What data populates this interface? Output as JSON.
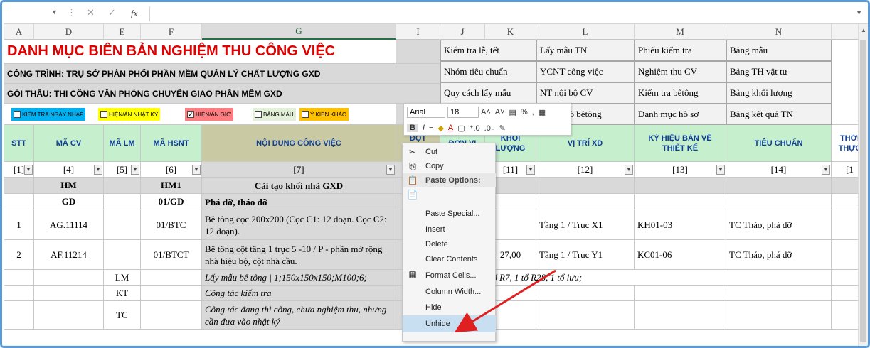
{
  "formula_bar": {
    "name_box": "",
    "fx": "fx",
    "cancel": "✕",
    "enter": "✓",
    "more": "⋮",
    "value": ""
  },
  "columns": [
    {
      "id": "A"
    },
    {
      "id": "D"
    },
    {
      "id": "E"
    },
    {
      "id": "F"
    },
    {
      "id": "G"
    },
    {
      "id": "I"
    },
    {
      "id": "J"
    },
    {
      "id": "K"
    },
    {
      "id": "L"
    },
    {
      "id": "M"
    },
    {
      "id": "N"
    }
  ],
  "sheet": {
    "title": "DANH MỤC BIÊN BẢN NGHIỆM THU CÔNG VIỆC",
    "project": "CÔNG TRÌNH: TRỤ SỞ PHÂN PHỐI PHẦN MỀM QUẢN LÝ CHẤT LƯỢNG GXD",
    "package": "GÓI THẦU: THI CÔNG VĂN PHÒNG CHUYỂN GIAO PHẦN MỀM GXD",
    "filters": [
      {
        "label": "KIỂM TRA NGÀY NHẬP",
        "checked": false,
        "color": "#00b0f0"
      },
      {
        "label": "HIỆN/ẨN NHẬT KÝ",
        "checked": false,
        "color": "#ffff00"
      },
      {
        "label": "HIỆN/ẨN GIỜ",
        "checked": true,
        "color": "#ff7c80"
      },
      {
        "label": "BẢNG MẪU",
        "checked": false,
        "color": "#e2efd9"
      },
      {
        "label": "Ý KIẾN KHÁC",
        "checked": false,
        "color": "#ffc000"
      }
    ],
    "quick_links": [
      [
        "Kiểm tra lễ, tết",
        "Lấy mẫu TN",
        "Phiếu kiểm tra",
        "Bảng mẫu"
      ],
      [
        "Nhóm tiêu chuẩn",
        "YCNT công việc",
        "Nghiệm thu CV",
        "Bảng TH vật tư"
      ],
      [
        "Quy cách lấy mẫu",
        "NT nội bộ CV",
        "Kiểm tra bêtông",
        "Bảng khối lượng"
      ],
      [
        "",
        "Dỡ bỏ cõ bêtông",
        "Danh mục hồ sơ",
        "Bảng kết quả TN"
      ]
    ],
    "headers": [
      "STT",
      "MÃ CV",
      "MÃ LM",
      "MÃ HSNT",
      "NỘI DUNG CÔNG VIỆC",
      "ĐỘT THANH",
      "ĐƠN VỊ",
      "KHỐI LƯỢNG",
      "VỊ TRÍ XD",
      "KÝ HIỆU BẢN VẼ THIẾT KẾ",
      "TIÊU CHUẨN",
      "THỜI THỰC"
    ],
    "indexes": [
      "[1]",
      "[4]",
      "[5]",
      "[6]",
      "[7]",
      "",
      "",
      "[11]",
      "[12]",
      "[13]",
      "[14]",
      "[1"
    ],
    "rows": [
      {
        "stt": "",
        "macv": "HM",
        "malm": "",
        "mahs": "HM1",
        "nd": "Cải tạo khối nhà GXD",
        "kl": "",
        "vt": "",
        "kh": "",
        "tc": ""
      },
      {
        "stt": "",
        "macv": "GD",
        "malm": "",
        "mahs": "01/GD",
        "nd": "Phá dỡ, tháo dỡ",
        "kl": "",
        "vt": "",
        "kh": "",
        "tc": ""
      },
      {
        "stt": "1",
        "macv": "AG.11114",
        "malm": "",
        "mahs": "01/BTC",
        "nd": "Bê tông cọc 200x200 (Cọc C1: 12 đoạn. Cọc C2: 12 đoạn).",
        "kl": "",
        "vt": "Tầng 1 / Trục X1",
        "kh": "KH01-03",
        "tc": "TC Tháo, phá dỡ"
      },
      {
        "stt": "2",
        "macv": "AF.11214",
        "malm": "",
        "mahs": "01/BTCT",
        "nd": "Bê tông cột tầng 1 trục 5 -10 / P - phần mở rộng nhà hiệu bộ, cột nhà cầu.",
        "kl": "27,00",
        "vt": "Tầng 1 / Trục Y1",
        "kh": "KC01-06",
        "tc": "TC Tháo, phá dỡ"
      },
      {
        "stt": "",
        "macv": "",
        "malm": "LM",
        "mahs": "",
        "nd": "Lấy mẫu bê tông | 1;150x150x150;M100;6;",
        "overflow": "viện / 1 tổ;1 tổ R7, 1 tổ R28, 1 tổ lưu;"
      },
      {
        "stt": "",
        "macv": "",
        "malm": "KT",
        "mahs": "",
        "nd": "Công tác kiểm tra"
      },
      {
        "stt": "",
        "macv": "",
        "malm": "TC",
        "mahs": "",
        "nd": "Công tác đang thi công, chưa nghiệm thu, nhưng cần đưa vào nhật ký"
      }
    ]
  },
  "mini_toolbar": {
    "font": "Arial",
    "size": "18",
    "bold": "B",
    "italic": "I",
    "percent": "%",
    "comma": ","
  },
  "context_menu": {
    "items": [
      {
        "label": "Cut",
        "icon": "scissors-icon",
        "glyph": "✂"
      },
      {
        "label": "Copy",
        "icon": "copy-icon",
        "glyph": "⎘"
      },
      {
        "label": "Paste Options:",
        "icon": "paste-icon",
        "glyph": "📋",
        "section": true
      },
      {
        "label": "",
        "icon": "paste-option-icon",
        "glyph": "📄"
      },
      {
        "label": "Paste Special...",
        "icon": "",
        "glyph": ""
      },
      {
        "label": "Insert",
        "icon": "",
        "glyph": ""
      },
      {
        "label": "Delete",
        "icon": "",
        "glyph": ""
      },
      {
        "label": "Clear Contents",
        "icon": "",
        "glyph": ""
      },
      {
        "label": "Format Cells...",
        "icon": "format-cells-icon",
        "glyph": "▦"
      },
      {
        "label": "Column Width...",
        "icon": "",
        "glyph": ""
      },
      {
        "label": "Hide",
        "icon": "",
        "glyph": ""
      },
      {
        "label": "Unhide",
        "icon": "",
        "glyph": "",
        "highlight": true
      }
    ]
  },
  "annotation": {
    "color": "#e02020"
  }
}
